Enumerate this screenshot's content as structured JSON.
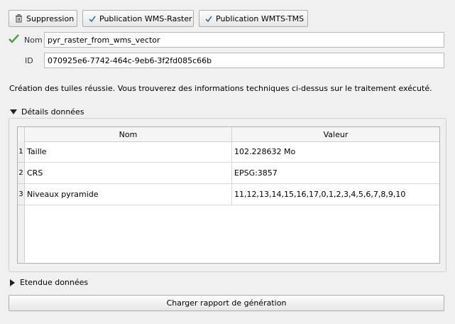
{
  "toolbar": {
    "delete_label": "Suppression",
    "wms_raster_label": "Publication WMS-Raster",
    "wmts_tms_label": "Publication WMTS-TMS"
  },
  "form": {
    "name_label": "Nom",
    "name_value": "pyr_raster_from_wms_vector",
    "id_label": "ID",
    "id_value": "070925e6-7742-464c-9eb6-3f2fd085c66b"
  },
  "status_message": "Création des tuiles réussie. Vous trouverez des informations techniques ci-dessus sur le traitement exécuté.",
  "details": {
    "title": "Détails données",
    "expanded": true,
    "columns": [
      "Nom",
      "Valeur"
    ],
    "rows": [
      {
        "num": "1",
        "name": "Taille",
        "value": "102.228632 Mo"
      },
      {
        "num": "2",
        "name": "CRS",
        "value": "EPSG:3857"
      },
      {
        "num": "3",
        "name": "Niveaux pyramide",
        "value": "11,12,13,14,15,16,17,0,1,2,3,4,5,6,7,8,9,10"
      }
    ]
  },
  "extent": {
    "title": "Etendue données",
    "expanded": false
  },
  "report_button_label": "Charger rapport de génération",
  "colors": {
    "valid_check": "#3aa535",
    "button_check": "#2a6ebd"
  },
  "icons": {
    "delete": "trash-icon",
    "publish": "checkmark-icon",
    "valid": "checkmark-icon",
    "expanded": "triangle-down-icon",
    "collapsed": "triangle-right-icon"
  }
}
